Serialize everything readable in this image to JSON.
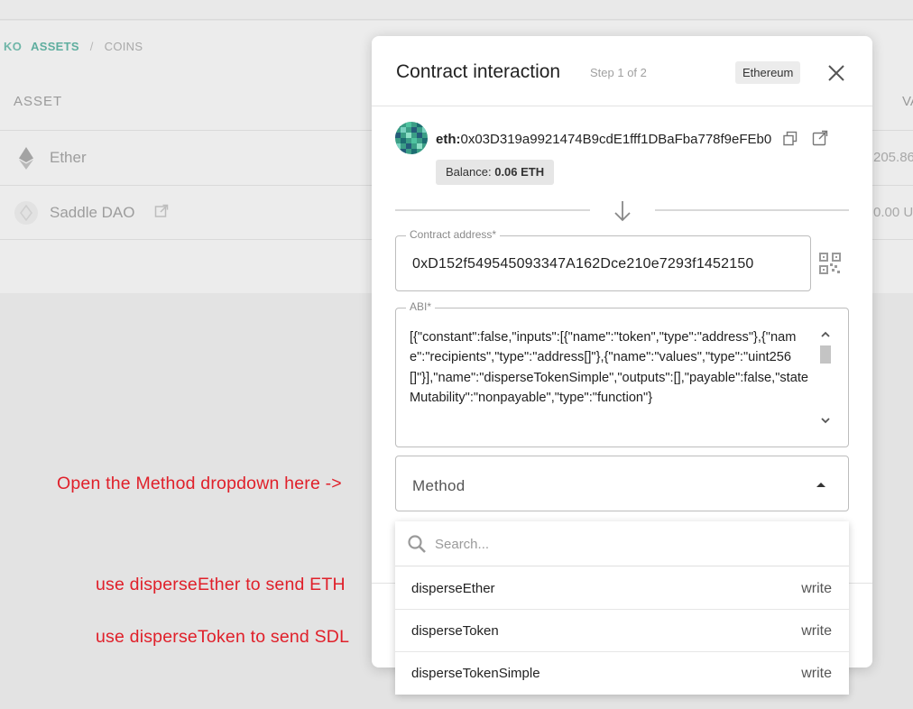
{
  "background": {
    "breadcrumb": {
      "logo_fragment": "KO",
      "assets": "ASSETS",
      "separator": "/",
      "coins": "COINS"
    },
    "table": {
      "col_asset": "ASSET",
      "col_value": "VA",
      "rows": [
        {
          "name": "Ether",
          "value": "205.86",
          "icon": "ethereum-icon"
        },
        {
          "name": "Saddle DAO",
          "value": "0.00 U",
          "icon": "token-icon"
        }
      ]
    }
  },
  "modal": {
    "title": "Contract interaction",
    "step": "Step 1 of 2",
    "network": "Ethereum",
    "account": {
      "prefix": "eth:",
      "address": "0x03D319a9921474B9cdE1fff1DBaFba778f9eFEb0",
      "balance_label": "Balance:",
      "balance_value": "0.06 ETH"
    },
    "contract_address": {
      "label": "Contract address*",
      "value": "0xD152f549545093347A162Dce210e7293f1452150"
    },
    "abi": {
      "label": "ABI*",
      "value": "[{\"constant\":false,\"inputs\":[{\"name\":\"token\",\"type\":\"address\"},{\"name\":\"recipients\",\"type\":\"address[]\"},{\"name\":\"values\",\"type\":\"uint256[]\"}],\"name\":\"disperseTokenSimple\",\"outputs\":[],\"payable\":false,\"stateMutability\":\"nonpayable\",\"type\":\"function\"}"
    },
    "method": {
      "placeholder": "Method"
    }
  },
  "dropdown": {
    "search_placeholder": "Search...",
    "items": [
      {
        "name": "disperseEther",
        "kind": "write"
      },
      {
        "name": "disperseToken",
        "kind": "write"
      },
      {
        "name": "disperseTokenSimple",
        "kind": "write"
      }
    ]
  },
  "annotations": {
    "open_method": "Open the Method dropdown here ->",
    "use_ether": "use disperseEther to send ETH",
    "use_token": "use disperseToken to send SDL"
  },
  "colors": {
    "annotation": "#e0202a",
    "accent": "#5fae9f"
  }
}
